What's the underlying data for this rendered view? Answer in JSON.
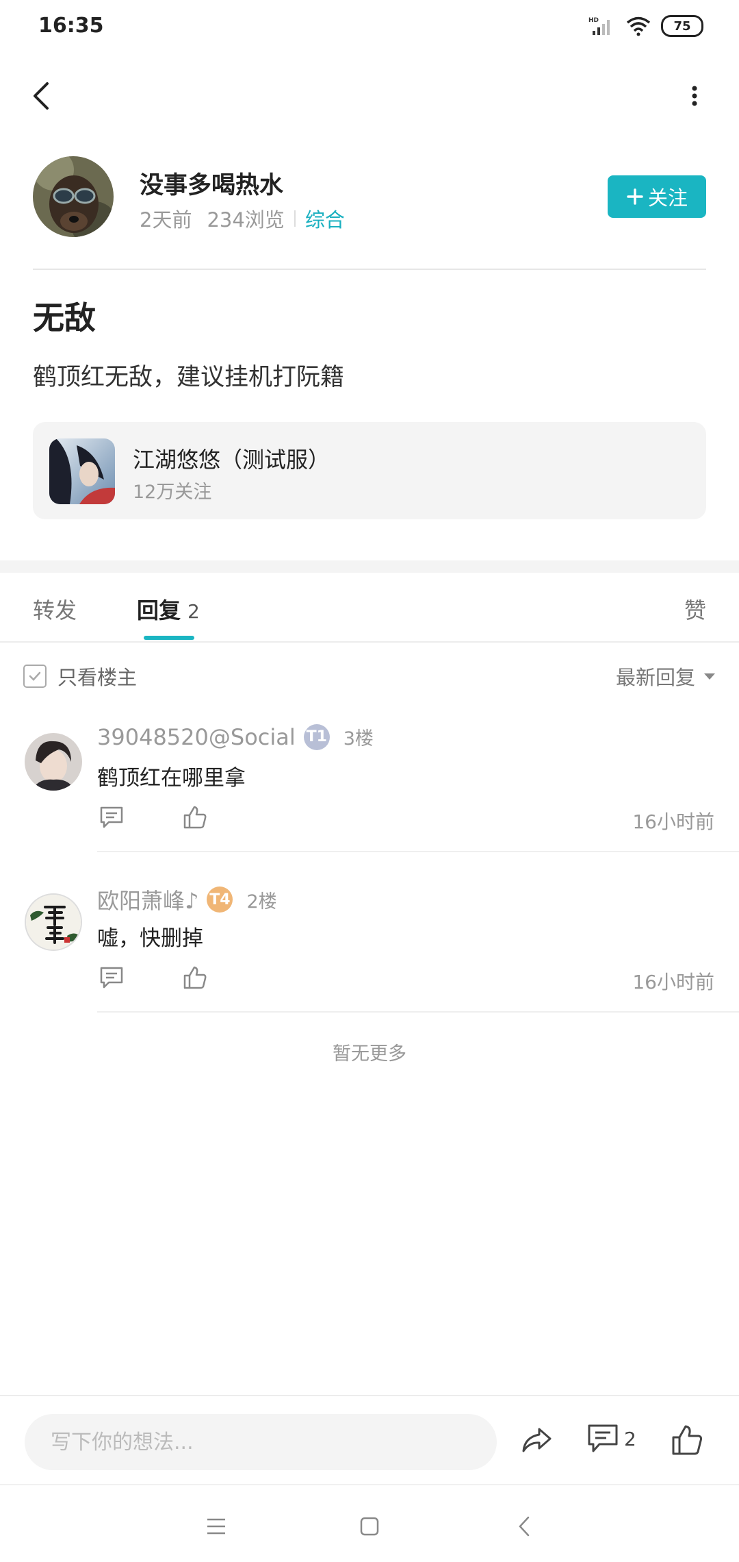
{
  "status": {
    "time": "16:35",
    "battery": "75"
  },
  "author": {
    "name": "没事多喝热水",
    "time_ago": "2天前",
    "views": "234浏览",
    "category": "综合",
    "follow_label": "关注"
  },
  "post": {
    "title": "无敌",
    "body": "鹤顶红无敌，建议挂机打阮籍"
  },
  "game": {
    "name": "江湖悠悠（测试服）",
    "followers": "12万关注"
  },
  "tabs": {
    "forward": "转发",
    "reply": "回复",
    "reply_count": "2",
    "like": "赞"
  },
  "filter": {
    "only_op": "只看楼主",
    "sort": "最新回复"
  },
  "comments": [
    {
      "name": "39048520@Social",
      "badge": "T1",
      "floor": "3楼",
      "text": "鹤顶红在哪里拿",
      "time": "16小时前"
    },
    {
      "name": "欧阳萧峰♪",
      "badge": "T4",
      "floor": "2楼",
      "text": "嘘，快删掉",
      "time": "16小时前"
    }
  ],
  "no_more": "暂无更多",
  "bottom": {
    "placeholder": "写下你的想法...",
    "comment_count": "2"
  },
  "colors": {
    "accent": "#1ab5c2"
  }
}
